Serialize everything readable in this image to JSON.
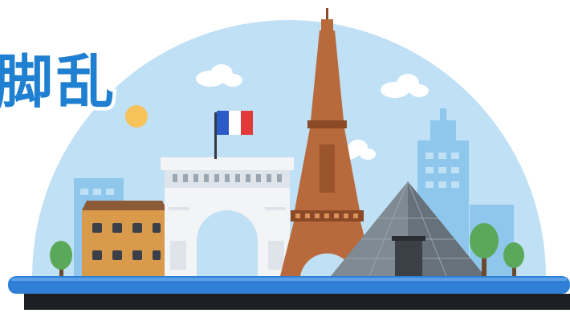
{
  "headline": "脚乱",
  "colors": {
    "sky_dome": "#bfe0f5",
    "skyline_blue": "#8fc6ec",
    "title_blue": "#1f7fd0",
    "eiffel_brown": "#b86a3c",
    "arch_white": "#f2f4f6",
    "pyramid_gray": "#7f8a93",
    "ground_blue": "#2f7fd6",
    "ground_shadow": "#1c1f24",
    "tree_green": "#5aa95a",
    "flag_blue": "#2a5bc9",
    "flag_white": "#ffffff",
    "flag_red": "#e2393a"
  },
  "icons": [
    "eiffel-tower-icon",
    "arc-de-triomphe-icon",
    "louvre-pyramid-icon",
    "french-flag-icon",
    "cloud-icon",
    "tree-icon",
    "building-icon"
  ]
}
